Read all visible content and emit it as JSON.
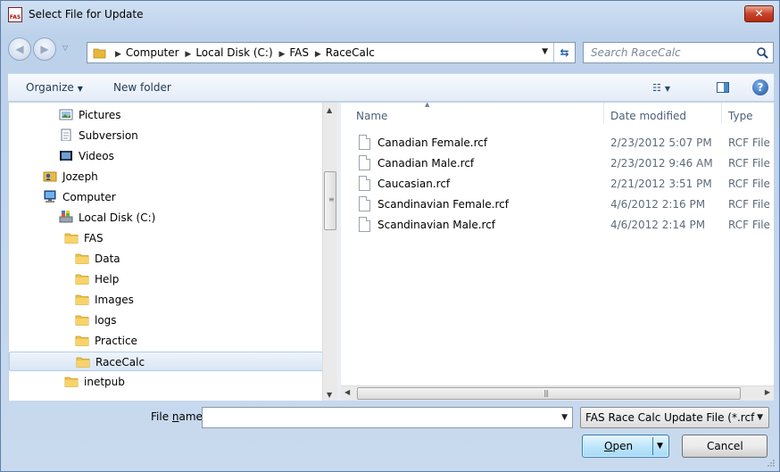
{
  "window": {
    "title": "Select File for Update",
    "app_icon_text": "FAS",
    "close_label": "✕"
  },
  "address": {
    "crumbs": [
      "Computer",
      "Local Disk (C:)",
      "FAS",
      "RaceCalc"
    ],
    "search_placeholder": "Search RaceCalc"
  },
  "toolbar": {
    "organize_label": "Organize",
    "new_folder_label": "New folder"
  },
  "tree": [
    {
      "label": "Pictures",
      "indent": 1,
      "icon": "pictures-icon"
    },
    {
      "label": "Subversion",
      "indent": 1,
      "icon": "document-icon"
    },
    {
      "label": "Videos",
      "indent": 1,
      "icon": "videos-icon"
    },
    {
      "label": "Jozeph",
      "indent": 0,
      "icon": "user-icon"
    },
    {
      "label": "Computer",
      "indent": 0,
      "icon": "computer-icon"
    },
    {
      "label": "Local Disk (C:)",
      "indent": 1,
      "icon": "disk-icon"
    },
    {
      "label": "FAS",
      "indent": 2,
      "icon": "folder-icon"
    },
    {
      "label": "Data",
      "indent": 3,
      "icon": "folder-icon"
    },
    {
      "label": "Help",
      "indent": 3,
      "icon": "folder-icon"
    },
    {
      "label": "Images",
      "indent": 3,
      "icon": "folder-icon"
    },
    {
      "label": "logs",
      "indent": 3,
      "icon": "folder-icon"
    },
    {
      "label": "Practice",
      "indent": 3,
      "icon": "folder-icon"
    },
    {
      "label": "RaceCalc",
      "indent": 3,
      "icon": "folder-icon",
      "selected": true
    },
    {
      "label": "inetpub",
      "indent": 2,
      "icon": "folder-icon"
    }
  ],
  "columns": {
    "name": "Name",
    "date": "Date modified",
    "type": "Type"
  },
  "files": [
    {
      "name": "Canadian Female.rcf",
      "date": "2/23/2012 5:07 PM",
      "type": "RCF File"
    },
    {
      "name": "Canadian Male.rcf",
      "date": "2/23/2012 9:46 AM",
      "type": "RCF File"
    },
    {
      "name": "Caucasian.rcf",
      "date": "2/21/2012 3:51 PM",
      "type": "RCF File"
    },
    {
      "name": "Scandinavian Female.rcf",
      "date": "4/6/2012 2:16 PM",
      "type": "RCF File"
    },
    {
      "name": "Scandinavian Male.rcf",
      "date": "4/6/2012 2:14 PM",
      "type": "RCF File"
    }
  ],
  "bottom": {
    "filename_label_pre": "File ",
    "filename_label_u": "n",
    "filename_label_post": "ame:",
    "filename_value": "",
    "filetype_value": "FAS Race Calc Update File (*.rcf",
    "open_label_u": "O",
    "open_label_rest": "pen",
    "cancel_label": "Cancel"
  }
}
